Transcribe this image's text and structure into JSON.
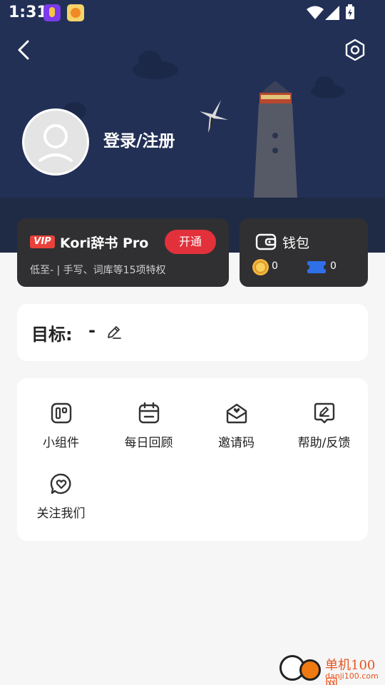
{
  "status_bar": {
    "time": "1:31"
  },
  "header": {
    "back_icon": "chevron-left-icon",
    "settings_icon": "hexagon-settings-icon",
    "login_label": "登录/注册"
  },
  "vip_card": {
    "badge": "VIP",
    "title": "Kori辞书 Pro",
    "open_label": "开通",
    "description": "低至- | 手写、词库等15项特权",
    "accent": "#e2313b"
  },
  "wallet": {
    "title": "钱包",
    "coins": "0",
    "tickets": "0"
  },
  "goal": {
    "label": "目标:",
    "value": "-"
  },
  "tools": [
    {
      "label": "小组件",
      "icon": "widget-icon"
    },
    {
      "label": "每日回顾",
      "icon": "calendar-icon"
    },
    {
      "label": "邀请码",
      "icon": "invite-envelope-icon"
    },
    {
      "label": "帮助/反馈",
      "icon": "feedback-edit-icon"
    },
    {
      "label": "关注我们",
      "icon": "heart-chat-icon"
    }
  ],
  "watermark": {
    "text": "单机100网",
    "sub": "danji100.com"
  }
}
